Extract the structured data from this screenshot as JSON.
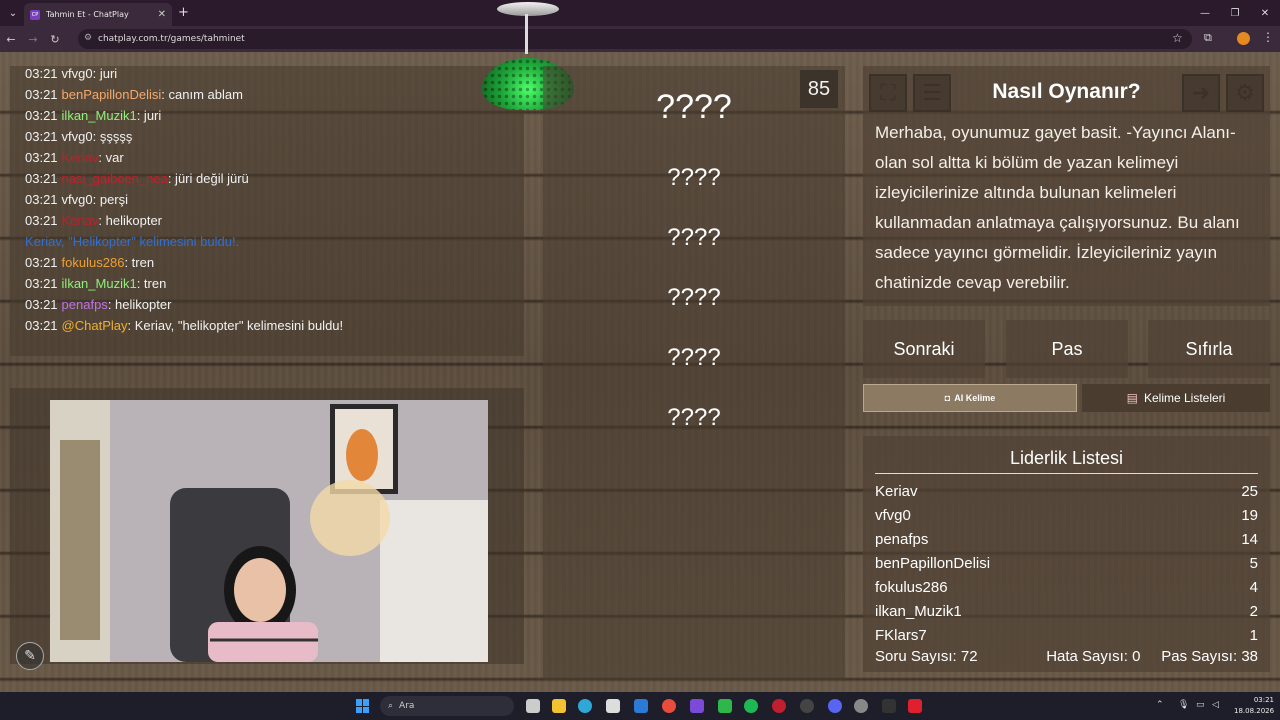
{
  "browser": {
    "tab_title": "Tahmin Et - ChatPlay",
    "tab_favicon": "CP",
    "new_tab": "+",
    "url": "chatplay.com.tr/games/tahminet"
  },
  "chat": {
    "messages": [
      {
        "time": "03:21",
        "user": "vfvg0",
        "user_color": "#f1f1f1",
        "text": ": juri"
      },
      {
        "time": "03:21",
        "user": "benPapillonDelisi",
        "user_color": "#f6a96b",
        "text": ": canım ablam"
      },
      {
        "time": "03:21",
        "user": "ilkan_Muzik1",
        "user_color": "#8ef07a",
        "text": ": juri"
      },
      {
        "time": "03:21",
        "user": "vfvg0",
        "user_color": "#f1f1f1",
        "text": ": şşşşş"
      },
      {
        "time": "03:21",
        "user": "Keriav",
        "user_color": "#c21f2b",
        "text": ": var"
      },
      {
        "time": "03:21",
        "user": "nasi_gaiboen_nea",
        "user_color": "#c21f2b",
        "text": ": jüri değil jürü"
      },
      {
        "time": "03:21",
        "user": "vfvg0",
        "user_color": "#f1f1f1",
        "text": ": perşi"
      },
      {
        "time": "03:21",
        "user": "Keriav",
        "user_color": "#c21f2b",
        "text": ": helikopter"
      },
      {
        "time": "",
        "user": "Keriav, \"Helikopter\" kelimesini buldu!.",
        "user_color": "#2f6fd6",
        "text": ""
      },
      {
        "time": "03:21",
        "user": "fokulus286",
        "user_color": "#f0a030",
        "text": ": tren"
      },
      {
        "time": "03:21",
        "user": "ilkan_Muzik1",
        "user_color": "#8ef07a",
        "text": ": tren"
      },
      {
        "time": "03:21",
        "user": "penafps",
        "user_color": "#c070e8",
        "text": ": helikopter"
      },
      {
        "time": "03:21",
        "user": "@ChatPlay",
        "user_color": "#f0b030",
        "text": ": Keriav, \"helikopter\" kelimesini buldu!"
      }
    ]
  },
  "timer": "85",
  "words": [
    "????",
    "????",
    "????",
    "????",
    "????",
    "????"
  ],
  "howto": {
    "title": "Nasıl Oynanır?",
    "text": "Merhaba, oyunumuz gayet basit. -Yayıncı Alanı- olan sol altta ki bölüm de yazan kelimeyi izleyicilerinize altında bulunan kelimeleri kullanmadan anlatmaya çalışıyorsunuz. Bu alanı sadece yayıncı görmelidir. İzleyicileriniz yayın chatinizde cevap verebilir."
  },
  "actions": {
    "next": "Sonraki",
    "pass": "Pas",
    "reset": "Sıfırla"
  },
  "subtabs": {
    "ai": "AI Kelime",
    "lists": "Kelime Listeleri"
  },
  "leaderboard": {
    "title": "Liderlik Listesi",
    "rows": [
      {
        "name": "Keriav",
        "score": "25"
      },
      {
        "name": "vfvg0",
        "score": "19"
      },
      {
        "name": "penafps",
        "score": "14"
      },
      {
        "name": "benPapillonDelisi",
        "score": "5"
      },
      {
        "name": "fokulus286",
        "score": "4"
      },
      {
        "name": "ilkan_Muzik1",
        "score": "2"
      },
      {
        "name": "FKlars7",
        "score": "1"
      }
    ],
    "stats": {
      "questions_label": "Soru Sayısı:",
      "questions": "72",
      "errors_label": "Hata Sayısı:",
      "errors": "0",
      "passes_label": "Pas Sayısı:",
      "passes": "38"
    }
  },
  "taskbar": {
    "search": "Ara",
    "time": "03:21",
    "date": "18.08.2026"
  }
}
